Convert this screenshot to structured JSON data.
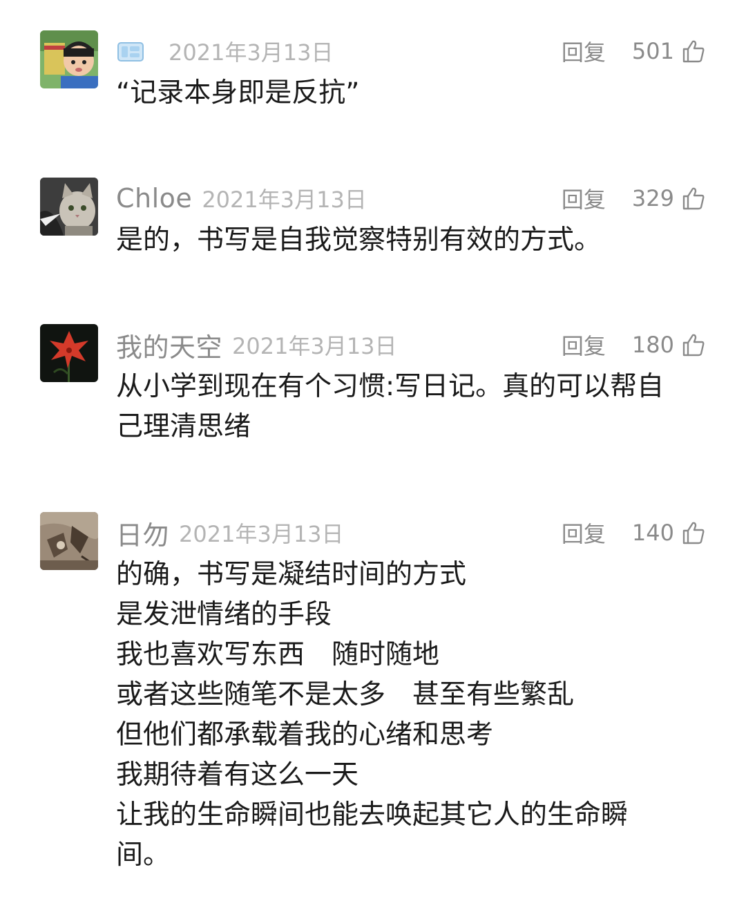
{
  "comments": [
    {
      "nickname": "",
      "date": "2021年3月13日",
      "reply_label": "回复",
      "likes": "501",
      "lines": [
        "“记录本身即是反抗”"
      ]
    },
    {
      "nickname": "Chloe",
      "date": "2021年3月13日",
      "reply_label": "回复",
      "likes": "329",
      "lines": [
        "是的，书写是自我觉察特别有效的方式。"
      ]
    },
    {
      "nickname": "我的天空",
      "date": "2021年3月13日",
      "reply_label": "回复",
      "likes": "180",
      "lines": [
        "从小学到现在有个习惯:写日记。真的可以帮自",
        "己理清思绪"
      ]
    },
    {
      "nickname": "日勿",
      "date": "2021年3月13日",
      "reply_label": "回复",
      "likes": "140",
      "lines": [
        "的确，书写是凝结时间的方式",
        "是发泄情绪的手段",
        "我也喜欢写东西　随时随地",
        "或者这些随笔不是太多　甚至有些繁乱",
        "但他们都承载着我的心绪和思考",
        "我期待着有这么一天",
        "让我的生命瞬间也能去唤起其它人的生命瞬",
        "间。"
      ]
    }
  ],
  "icons": {
    "like": "thumbs-up-icon",
    "badge": "ice-cube-badge-icon"
  },
  "colors": {
    "text": "#1a1a1a",
    "meta": "#8a8a8a",
    "date": "#b4b4b4",
    "badge": "#9cc9ea"
  }
}
